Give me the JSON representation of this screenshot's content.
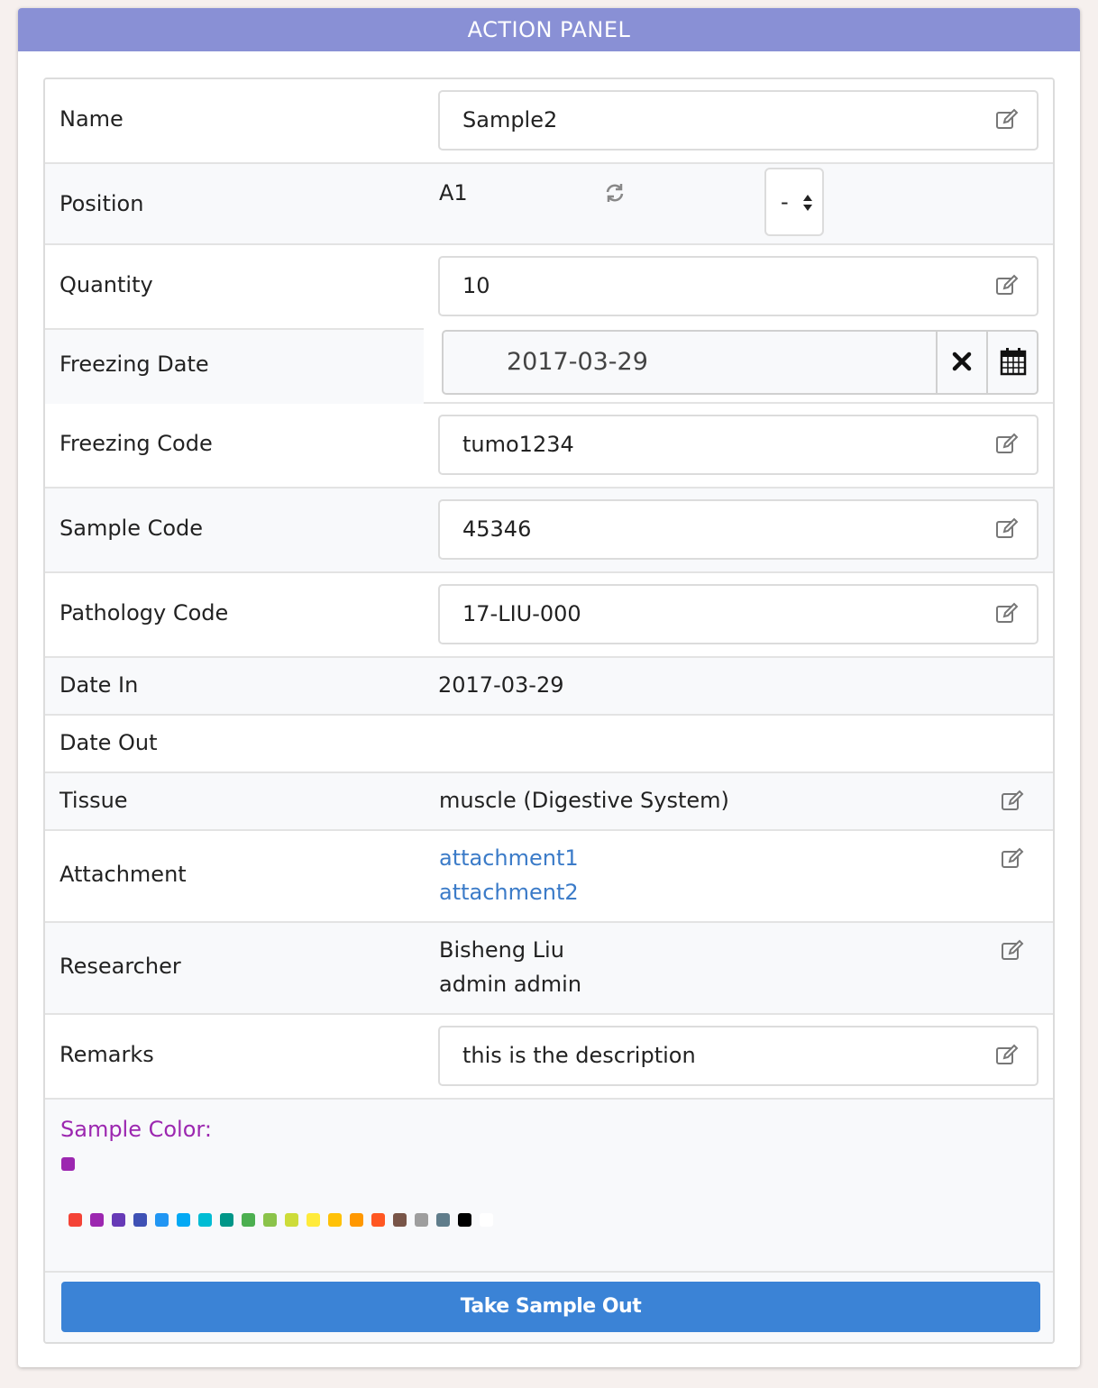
{
  "header": {
    "title": "ACTION PANEL"
  },
  "rows": {
    "name": {
      "label": "Name",
      "value": "Sample2"
    },
    "position": {
      "label": "Position",
      "value": "A1",
      "select_value": "-"
    },
    "quantity": {
      "label": "Quantity",
      "value": "10"
    },
    "freezing_date": {
      "label": "Freezing Date",
      "value": "2017-03-29"
    },
    "freezing_code": {
      "label": "Freezing Code",
      "value": "tumo1234"
    },
    "sample_code": {
      "label": "Sample Code",
      "value": "45346"
    },
    "pathology_code": {
      "label": "Pathology Code",
      "value": "17-LIU-000"
    },
    "date_in": {
      "label": "Date In",
      "value": "2017-03-29"
    },
    "date_out": {
      "label": "Date Out",
      "value": ""
    },
    "tissue": {
      "label": "Tissue",
      "value": "muscle (Digestive System)"
    },
    "attachment": {
      "label": "Attachment",
      "items": [
        "attachment1",
        "attachment2"
      ]
    },
    "researcher": {
      "label": "Researcher",
      "items": [
        "Bisheng Liu",
        "admin admin"
      ]
    },
    "remarks": {
      "label": "Remarks",
      "value": "this is the description"
    }
  },
  "sample_color": {
    "label": "Sample Color:",
    "selected": "#9c27b0",
    "palette": [
      "#f44336",
      "#9c27b0",
      "#673ab7",
      "#3f51b5",
      "#2196f3",
      "#03a9f4",
      "#00bcd4",
      "#009688",
      "#4caf50",
      "#8bc34a",
      "#cddc39",
      "#ffeb3b",
      "#ffc107",
      "#ff9800",
      "#ff5722",
      "#795548",
      "#9e9e9e",
      "#607d8b",
      "#000000",
      "#ffffff"
    ]
  },
  "actions": {
    "take_out_label": "Take Sample Out"
  },
  "colors": {
    "header": "#8990d5",
    "primary": "#3b83d6",
    "link": "#3b7bc8",
    "color_label": "#9c27b0"
  }
}
